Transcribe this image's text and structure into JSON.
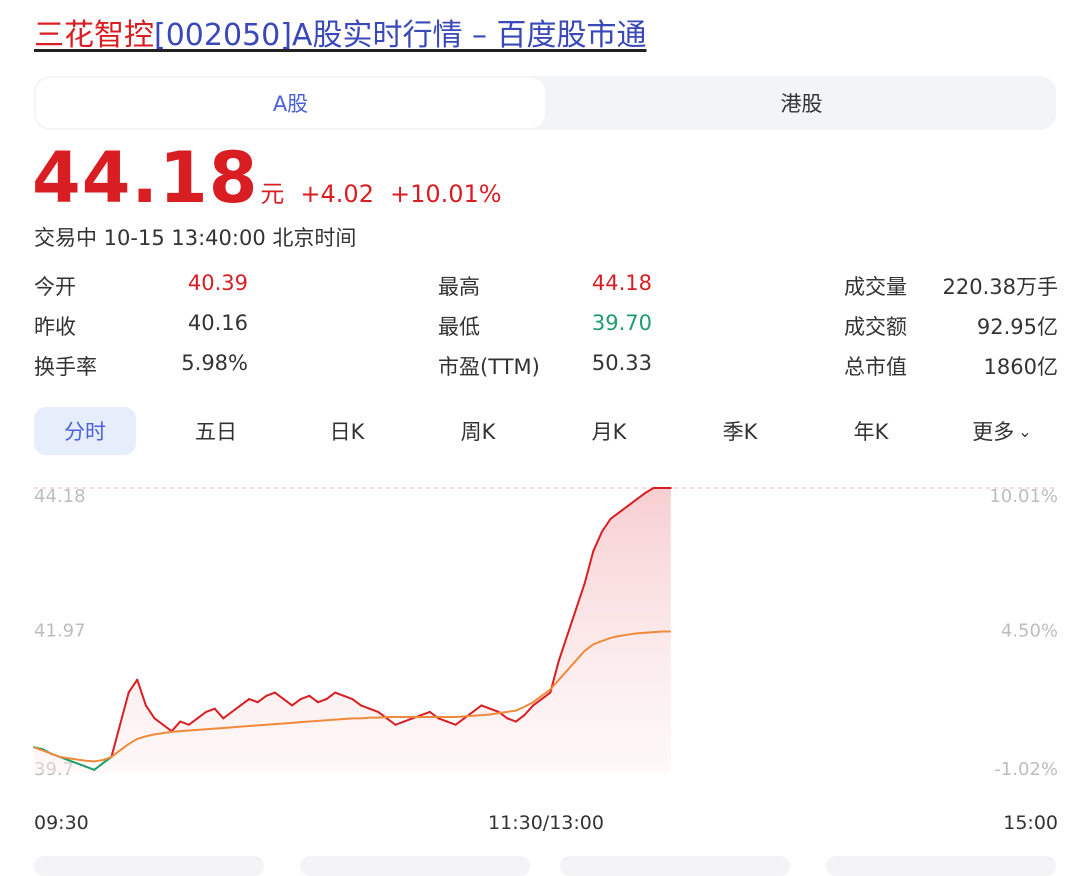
{
  "header": {
    "title_name": "三花智控",
    "title_rest": "[002050]A股实时行情 – 百度股市通"
  },
  "market_tabs": [
    {
      "label": "A股",
      "active": true
    },
    {
      "label": "港股",
      "active": false
    }
  ],
  "quote": {
    "price": "44.18",
    "unit": "元",
    "change": "+4.02",
    "change_pct": "+10.01%",
    "status": "交易中 10-15 13:40:00 北京时间"
  },
  "stats": [
    [
      {
        "label": "今开",
        "value": "40.39"
      },
      {
        "label": "最高",
        "value": "44.18"
      },
      {
        "label": "成交量",
        "value": "220.38万手"
      }
    ],
    [
      {
        "label": "昨收",
        "value": "40.16"
      },
      {
        "label": "最低",
        "value": "39.70"
      },
      {
        "label": "成交额",
        "value": "92.95亿"
      }
    ],
    [
      {
        "label": "换手率",
        "value": "5.98%"
      },
      {
        "label": "市盈(TTM)",
        "value": "50.33"
      },
      {
        "label": "总市值",
        "value": "1860亿"
      }
    ]
  ],
  "period_tabs": [
    {
      "label": "分时",
      "active": true
    },
    {
      "label": "五日"
    },
    {
      "label": "日K"
    },
    {
      "label": "周K"
    },
    {
      "label": "月K"
    },
    {
      "label": "季K"
    },
    {
      "label": "年K"
    },
    {
      "label": "更多"
    }
  ],
  "colors": {
    "up": "#d81e22",
    "down": "#1e9d6b",
    "accent": "#4c61d9",
    "avg": "#f08a3a"
  },
  "chart_data": {
    "type": "line",
    "y_left_labels": [
      "44.18",
      "41.97",
      "39.7"
    ],
    "y_right_labels": [
      "10.01%",
      "4.50%",
      "-1.02%"
    ],
    "x_labels": [
      "09:30",
      "11:30/13:00",
      "15:00"
    ],
    "prev_close": 40.16,
    "ylim": [
      39.75,
      44.18
    ],
    "series": [
      {
        "name": "price",
        "values": [
          40.15,
          40.12,
          40.05,
          40.0,
          39.95,
          39.9,
          39.85,
          39.8,
          39.9,
          40.0,
          40.5,
          41.0,
          41.2,
          40.8,
          40.6,
          40.5,
          40.4,
          40.55,
          40.5,
          40.6,
          40.7,
          40.75,
          40.6,
          40.7,
          40.8,
          40.9,
          40.85,
          40.95,
          41.0,
          40.9,
          40.8,
          40.9,
          40.95,
          40.85,
          40.9,
          41.0,
          40.95,
          40.9,
          40.8,
          40.75,
          40.7,
          40.6,
          40.5,
          40.55,
          40.6,
          40.65,
          40.7,
          40.6,
          40.55,
          40.5,
          40.6,
          40.7,
          40.8,
          40.75,
          40.7,
          40.6,
          40.55,
          40.65,
          40.8,
          40.9,
          41.0,
          41.5,
          41.9,
          42.3,
          42.7,
          43.2,
          43.5,
          43.7,
          43.8,
          43.9,
          44.0,
          44.1,
          44.18,
          44.18,
          44.18
        ]
      },
      {
        "name": "avg",
        "values": [
          40.15,
          40.1,
          40.05,
          40.0,
          39.98,
          39.96,
          39.94,
          39.93,
          39.95,
          40.0,
          40.1,
          40.2,
          40.28,
          40.32,
          40.35,
          40.37,
          40.39,
          40.4,
          40.41,
          40.42,
          40.43,
          40.44,
          40.45,
          40.46,
          40.47,
          40.48,
          40.49,
          40.5,
          40.51,
          40.52,
          40.53,
          40.54,
          40.55,
          40.56,
          40.57,
          40.58,
          40.59,
          40.6,
          40.6,
          40.61,
          40.61,
          40.62,
          40.62,
          40.62,
          40.62,
          40.62,
          40.62,
          40.62,
          40.62,
          40.62,
          40.63,
          40.64,
          40.65,
          40.66,
          40.68,
          40.7,
          40.72,
          40.78,
          40.85,
          40.95,
          41.05,
          41.2,
          41.35,
          41.5,
          41.65,
          41.75,
          41.8,
          41.85,
          41.88,
          41.9,
          41.92,
          41.93,
          41.94,
          41.95,
          41.95
        ]
      }
    ],
    "total_points": 120
  }
}
